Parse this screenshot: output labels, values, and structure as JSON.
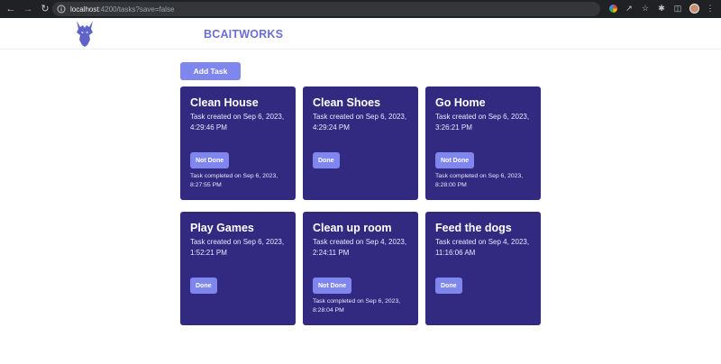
{
  "browser": {
    "url_host": "localhost",
    "url_path": ":4200/tasks?save=false"
  },
  "header": {
    "brand": "BCAITWORKS"
  },
  "main": {
    "add_task_label": "Add Task",
    "tasks": [
      {
        "title": "Clean House",
        "created": "Task created on Sep 6, 2023, 4:29:46 PM",
        "status_label": "Not Done",
        "completed": "Task completed on Sep 6, 2023, 8:27:55 PM"
      },
      {
        "title": "Clean Shoes",
        "created": "Task created on Sep 6, 2023, 4:29:24 PM",
        "status_label": "Done",
        "completed": ""
      },
      {
        "title": "Go Home",
        "created": "Task created on Sep 6, 2023, 3:26:21 PM",
        "status_label": "Not Done",
        "completed": "Task completed on Sep 6, 2023, 8:28:00 PM"
      },
      {
        "title": "Play Games",
        "created": "Task created on Sep 6, 2023, 1:52:21 PM",
        "status_label": "Done",
        "completed": ""
      },
      {
        "title": "Clean up room",
        "created": "Task created on Sep 4, 2023, 2:24:11 PM",
        "status_label": "Not Done",
        "completed": "Task completed on Sep 6, 2023, 8:28:04 PM"
      },
      {
        "title": "Feed the dogs",
        "created": "Task created on Sep 4, 2023, 11:16:06 AM",
        "status_label": "Done",
        "completed": ""
      }
    ]
  },
  "colors": {
    "brand": "#6a6fd4",
    "card_bg": "#312a80",
    "button": "#7f86ee"
  },
  "icons": [
    "back-arrow-icon",
    "forward-arrow-icon",
    "reload-icon",
    "site-info-icon",
    "google-lens-icon",
    "share-icon",
    "bookmark-star-icon",
    "extensions-icon",
    "side-panel-icon",
    "profile-avatar",
    "dragon-logo"
  ]
}
